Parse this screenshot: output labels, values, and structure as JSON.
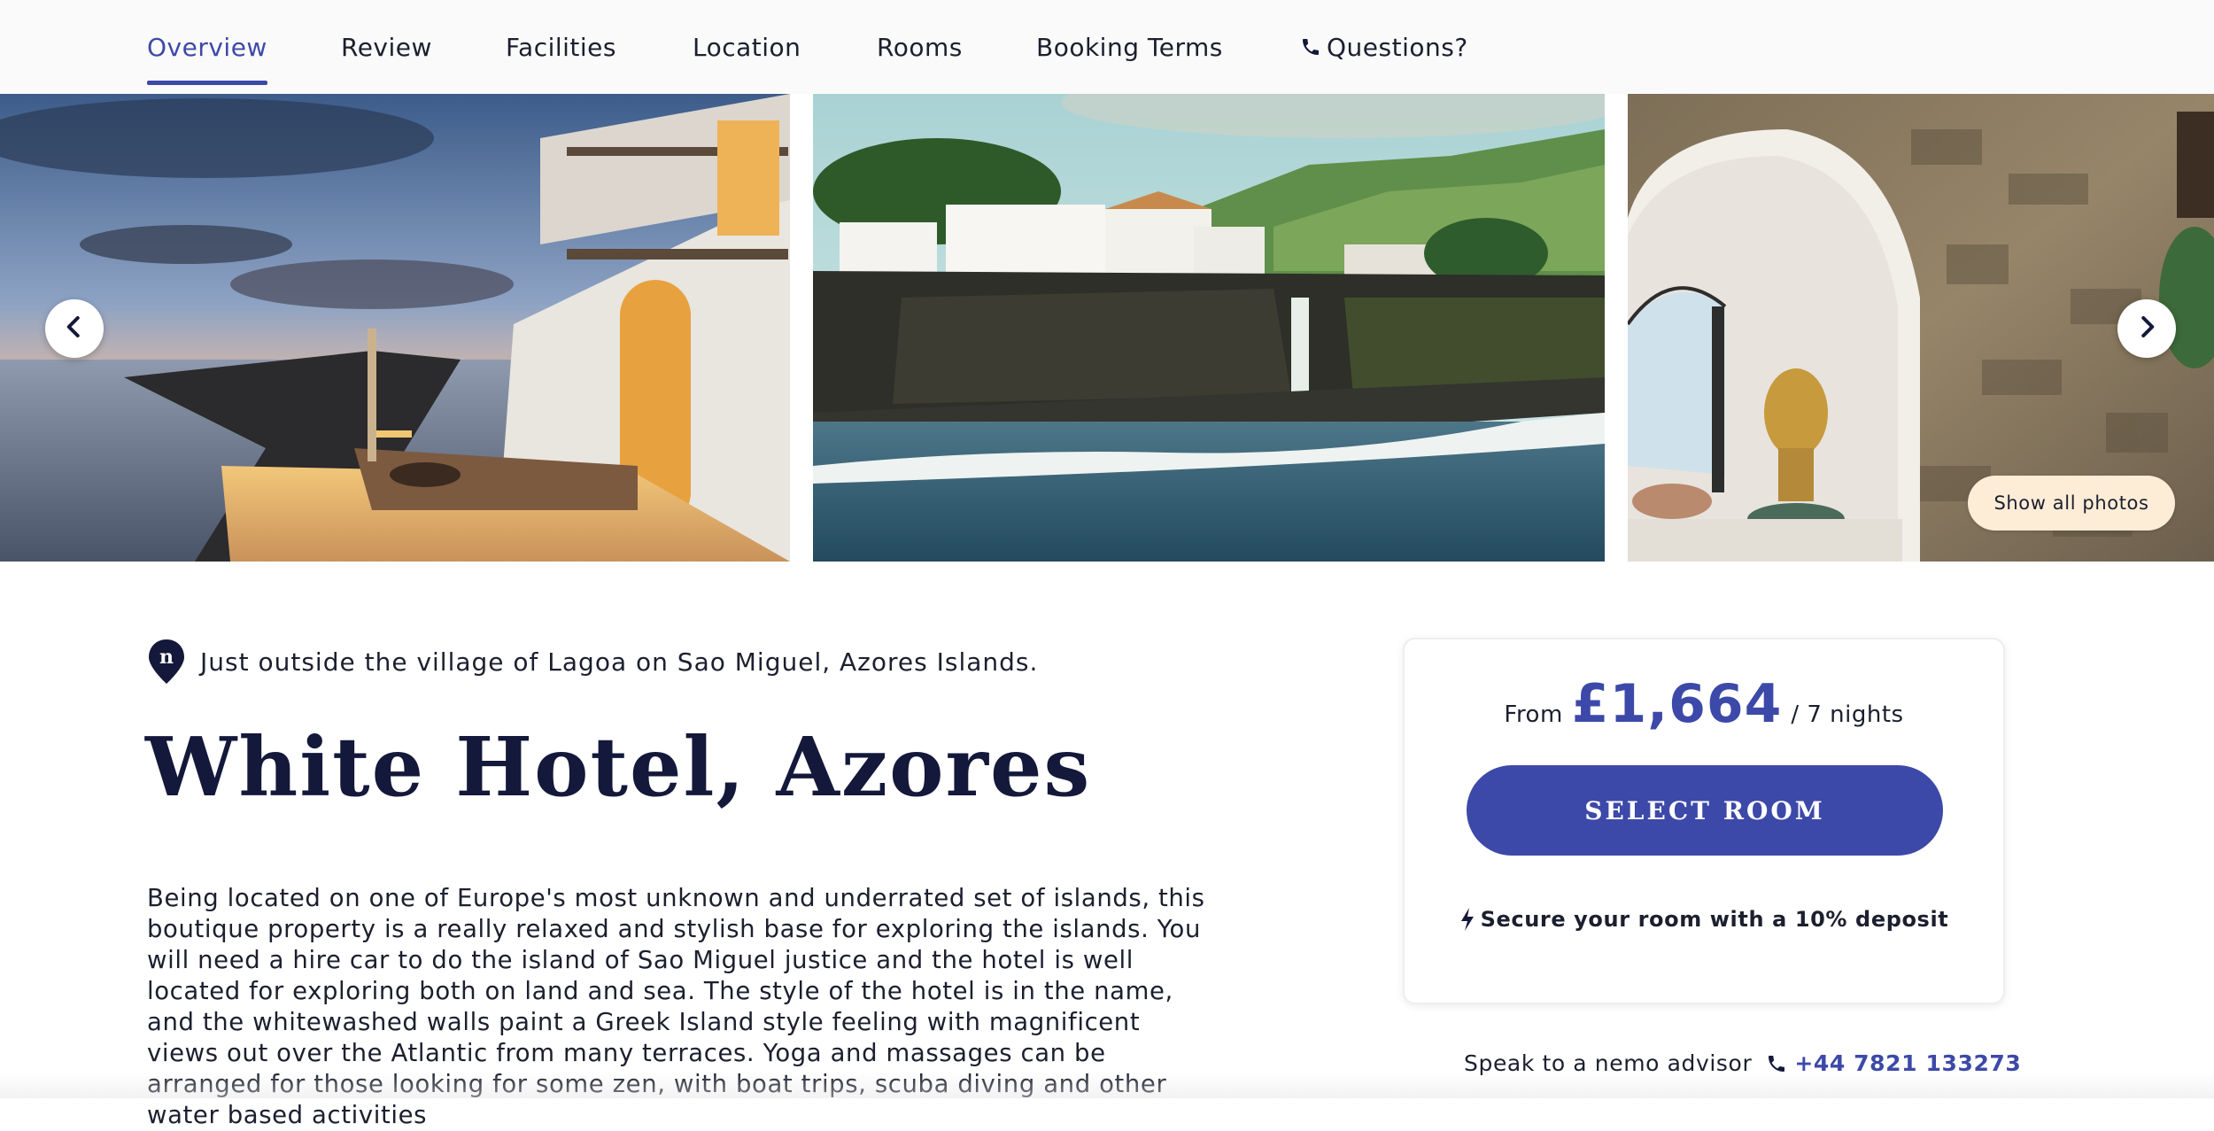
{
  "nav": {
    "tabs": [
      {
        "label": "Overview",
        "active": true
      },
      {
        "label": "Review"
      },
      {
        "label": "Facilities"
      },
      {
        "label": "Location"
      },
      {
        "label": "Rooms"
      },
      {
        "label": "Booking Terms"
      },
      {
        "label": "Questions?",
        "icon": "phone-icon"
      }
    ]
  },
  "gallery": {
    "photos": [
      "hotel-terrace-dusk",
      "hotel-on-cliffs-by-sea",
      "stone-archway-interior"
    ],
    "show_all_label": "Show all photos"
  },
  "hotel": {
    "location": "Just outside the village of Lagoa on Sao Miguel, Azores Islands.",
    "title": "White Hotel, Azores",
    "description": "Being located on one of Europe's most unknown and underrated set of islands, this boutique property is a really relaxed and stylish base for exploring the islands. You will need a hire car to do the island of Sao Miguel justice and the hotel is well located for exploring both on land and sea. The style of the hotel is in the name, and the whitewashed walls paint a Greek Island style feeling with magnificent views out over the Atlantic from many terraces. Yoga and massages can be arranged for those looking for some zen, with boat trips, scuba diving and other water based activities"
  },
  "booking": {
    "from_label": "From",
    "price": "£1,664",
    "nights": "/ 7 nights",
    "select_label": "SELECT ROOM",
    "deposit_text": "Secure your room with a 10% deposit"
  },
  "advisor": {
    "label": "Speak to a nemo advisor",
    "phone": "+44 7821 133273"
  },
  "colors": {
    "accent": "#3d49a8",
    "title": "#14183a",
    "pill": "#fdecd6"
  }
}
